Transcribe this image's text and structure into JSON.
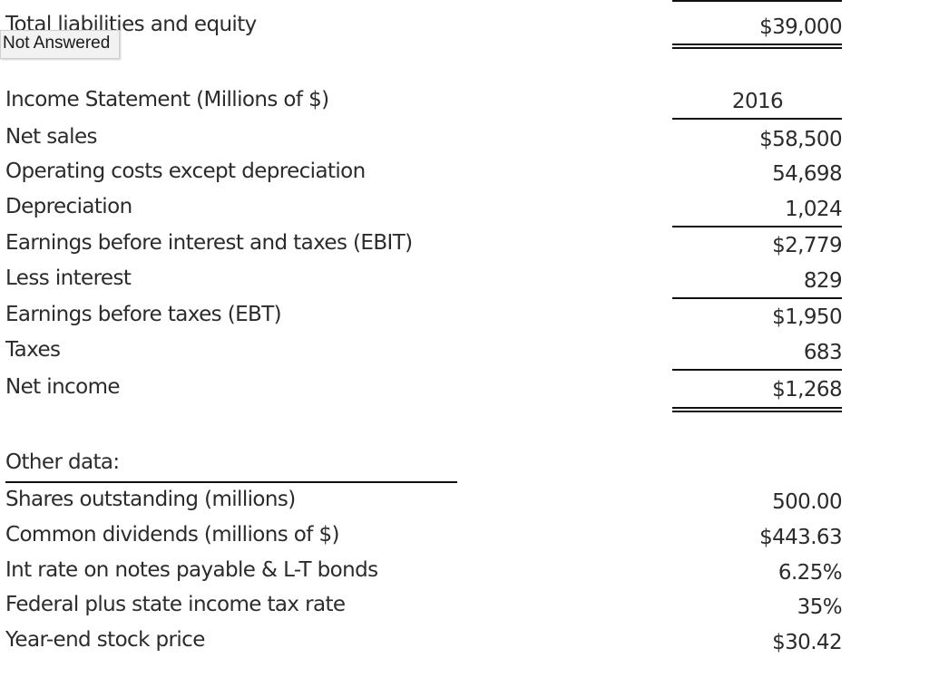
{
  "balance_sheet": {
    "total_label": "Total liabilities and equity",
    "total_value": "$39,000"
  },
  "tooltip": {
    "text": "Not Answered"
  },
  "income_statement": {
    "title": "Income Statement (Millions of $)",
    "year": "2016",
    "rows": [
      {
        "label": "Net sales",
        "value": "$58,500"
      },
      {
        "label": "Operating costs except depreciation",
        "value": "54,698"
      },
      {
        "label": "Depreciation",
        "value": "1,024"
      },
      {
        "label": "Earnings before interest and taxes (EBIT)",
        "value": "$2,779"
      },
      {
        "label": "Less interest",
        "value": "829"
      },
      {
        "label": "Earnings before taxes (EBT)",
        "value": "$1,950"
      },
      {
        "label": "Taxes",
        "value": "683"
      },
      {
        "label": "Net income",
        "value": "$1,268"
      }
    ]
  },
  "other_data": {
    "title": "Other data:",
    "rows": [
      {
        "label": "Shares outstanding (millions)",
        "value": "500.00"
      },
      {
        "label": "Common dividends (millions of $)",
        "value": "$443.63"
      },
      {
        "label": "Int rate on notes payable & L-T bonds",
        "value": "6.25%"
      },
      {
        "label": "Federal plus state income tax rate",
        "value": "35%"
      },
      {
        "label": "Year-end stock price",
        "value": "$30.42"
      }
    ]
  }
}
